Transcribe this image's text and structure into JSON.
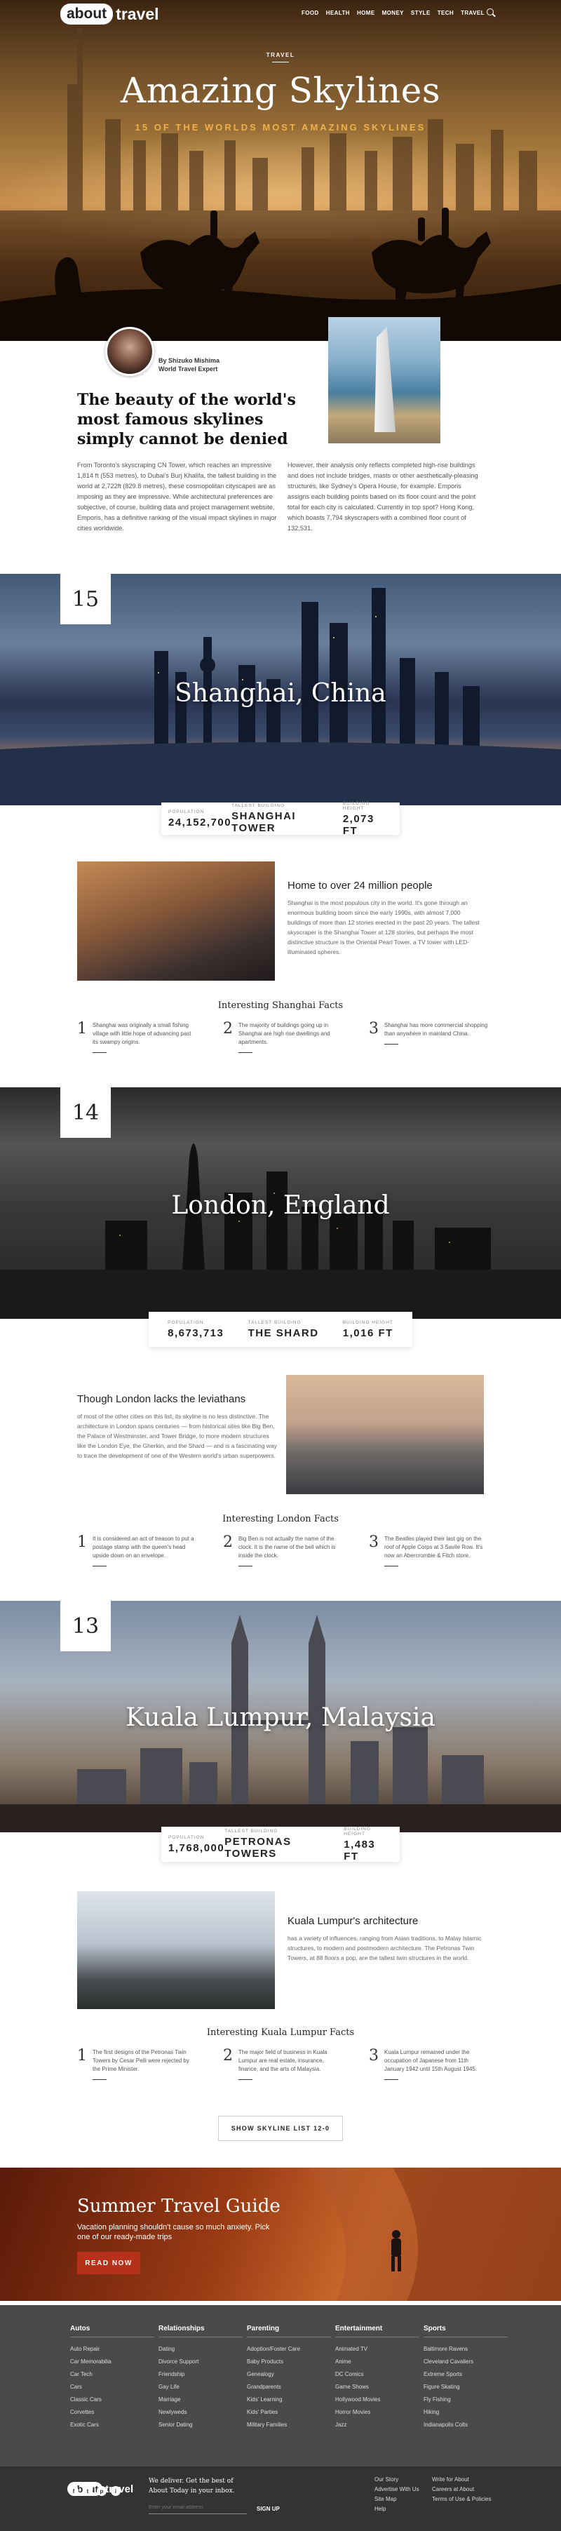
{
  "header": {
    "logo_pill": "about",
    "logo_word": "travel",
    "nav": [
      "FOOD",
      "HEALTH",
      "HOME",
      "MONEY",
      "STYLE",
      "TECH",
      "TRAVEL"
    ]
  },
  "hero": {
    "kicker": "TRAVEL",
    "title": "Amazing Skylines",
    "subtitle": "15 OF THE WORLDS MOST AMAZING SKYLINES"
  },
  "author": {
    "name": "By Shizuko Mishima",
    "role": "World Travel Expert"
  },
  "intro": {
    "heading": "The beauty of the world's most famous skylines simply cannot be denied",
    "col1": "From Toronto's skyscraping CN Tower, which reaches an impressive 1,814 ft (553 metres), to Dubai's Burj Khalifa, the tallest building in the world at 2,722ft (829.8 metres), these cosmopolitan cityscapes are as imposing as they are impressive. While architectural preferences are subjective, of course, building data and project management website, Emporis, has a definitive ranking of the visual impact skylines in major cities worldwide.",
    "col2": "However, their analysis only reflects completed high-rise buildings and does not include bridges, masts or other aesthetically-pleasing structures, like Sydney's Opera House, for example. Emporis assigns each building points based on its floor count and the point total for each city is calculated. Currently in top spot? Hong Kong, which boasts 7,794 skyscrapers with a combined floor count of 132,531."
  },
  "cities": [
    {
      "rank": "15",
      "name": "Shanghai, China",
      "stats": [
        {
          "label": "POPULATION",
          "value": "24,152,700"
        },
        {
          "label": "TALLEST BUILDING",
          "value": "SHANGHAI TOWER"
        },
        {
          "label": "BUILDING HEIGHT",
          "value": "2,073 FT"
        }
      ],
      "section_heading": "Home to over 24 million people",
      "section_text": "Shanghai is the most populous city in the world. It's gone through an enormous building boom since the early 1990s, with almost 7,000 buildings of more than 12 stories erected in the past 20 years. The tallest skyscraper is the Shanghai Tower at 128 stories, but perhaps the most distinctive structure is the Oriental Pearl Tower, a TV tower with LED-illuminated spheres.",
      "facts_title": "Interesting Shanghai Facts",
      "facts": [
        {
          "n": "1",
          "t": "Shanghai was originally a small fishing village with little hope of advancing past its swampy origins."
        },
        {
          "n": "2",
          "t": "The majority of buildings going up in Shanghai are high rise dwellings and apartments."
        },
        {
          "n": "3",
          "t": "Shanghai has more commercial shopping than anywhere in mainland China."
        }
      ]
    },
    {
      "rank": "14",
      "name": "London, England",
      "stats": [
        {
          "label": "POPULATION",
          "value": "8,673,713"
        },
        {
          "label": "TALLEST BUILDING",
          "value": "THE SHARD"
        },
        {
          "label": "BUILDING HEIGHT",
          "value": "1,016 FT"
        }
      ],
      "section_heading": "Though London lacks the leviathans",
      "section_text": "of most of the other cities on this list, its skyline is no less distinctive. The architecture in London spans centuries — from historical sites like Big Ben, the Palace of Westminster, and Tower Bridge, to more modern structures like the London Eye, the Gherkin, and the Shard — and is a fascinating way to trace the development of one of the Western world's urban superpowers.",
      "facts_title": "Interesting London Facts",
      "facts": [
        {
          "n": "1",
          "t": "It is considered an act of treason to put a postage stamp with the queen's head upside down on an envelope."
        },
        {
          "n": "2",
          "t": "Big Ben is not actually the name of the clock. It is the name of the bell which is inside the clock."
        },
        {
          "n": "3",
          "t": "The Beatles played their last gig on the roof of Apple Corps at 3 Savile Row. It's now an Abercrombie & Fitch store."
        }
      ]
    },
    {
      "rank": "13",
      "name": "Kuala Lumpur, Malaysia",
      "stats": [
        {
          "label": "POPULATION",
          "value": "1,768,000"
        },
        {
          "label": "TALLEST BUILDING",
          "value": "PETRONAS TOWERS"
        },
        {
          "label": "BUILDING HEIGHT",
          "value": "1,483 FT"
        }
      ],
      "section_heading": "Kuala Lumpur's architecture",
      "section_text": "has a variety of influences, ranging from Asian traditions, to Malay Islamic structures, to modern and postmodern architecture. The Petronas Twin Towers, at 88 floors a pop, are the tallest twin structures in the world.",
      "facts_title": "Interesting Kuala Lumpur Facts",
      "facts": [
        {
          "n": "1",
          "t": "The first designs of the Petronas Twin Towers by Cesar Pelli were rejected by the Prime Minister."
        },
        {
          "n": "2",
          "t": "The major field of business in Kuala Lumpur are real estate, insurance, finance, and the arts of Malaysia."
        },
        {
          "n": "3",
          "t": "Kuala Lumpur remained under the occupation of Japanese from 11th January 1942 until 15th August 1945."
        }
      ]
    }
  ],
  "show_list_label": "SHOW SKYLINE LIST 12-0",
  "promo": {
    "title": "Summer Travel Guide",
    "text": "Vacation planning shouldn't cause so much anxiety. Pick one of our ready-made trips",
    "button": "READ NOW"
  },
  "footer": {
    "columns": [
      {
        "title": "Autos",
        "links": [
          "Auto Repair",
          "Car Memorabilia",
          "Car Tech",
          "Cars",
          "Classic Cars",
          "Corvettes",
          "Exotic Cars"
        ]
      },
      {
        "title": "Relationships",
        "links": [
          "Dating",
          "Divorce Support",
          "Friendship",
          "Gay Life",
          "Marriage",
          "Newlyweds",
          "Senior Dating"
        ]
      },
      {
        "title": "Parenting",
        "links": [
          "Adoption/Foster Care",
          "Baby Products",
          "Genealogy",
          "Grandparents",
          "Kids' Learning",
          "Kids' Parties",
          "Military Families"
        ]
      },
      {
        "title": "Entertainment",
        "links": [
          "Animated TV",
          "Anime",
          "DC Comics",
          "Game Shows",
          "Hollywood Movies",
          "Horror Movies",
          "Jazz"
        ]
      },
      {
        "title": "Sports",
        "links": [
          "Baltimore Ravens",
          "Cleveland Cavaliers",
          "Extreme Sports",
          "Figure Skating",
          "Fly Fishing",
          "Hiking",
          "Indianapolis Colts"
        ]
      }
    ],
    "newsletter": "We deliver. Get the best of About Today in your inbox.",
    "email_placeholder": "Enter your email address",
    "signup": "SIGN UP",
    "links_a": [
      "Our Story",
      "Advertise With Us",
      "Site Map",
      "Help"
    ],
    "links_b": [
      "Write for About",
      "Careers at About",
      "Terms of Use & Policies"
    ],
    "social": [
      "f",
      "t",
      "p",
      "i"
    ]
  }
}
